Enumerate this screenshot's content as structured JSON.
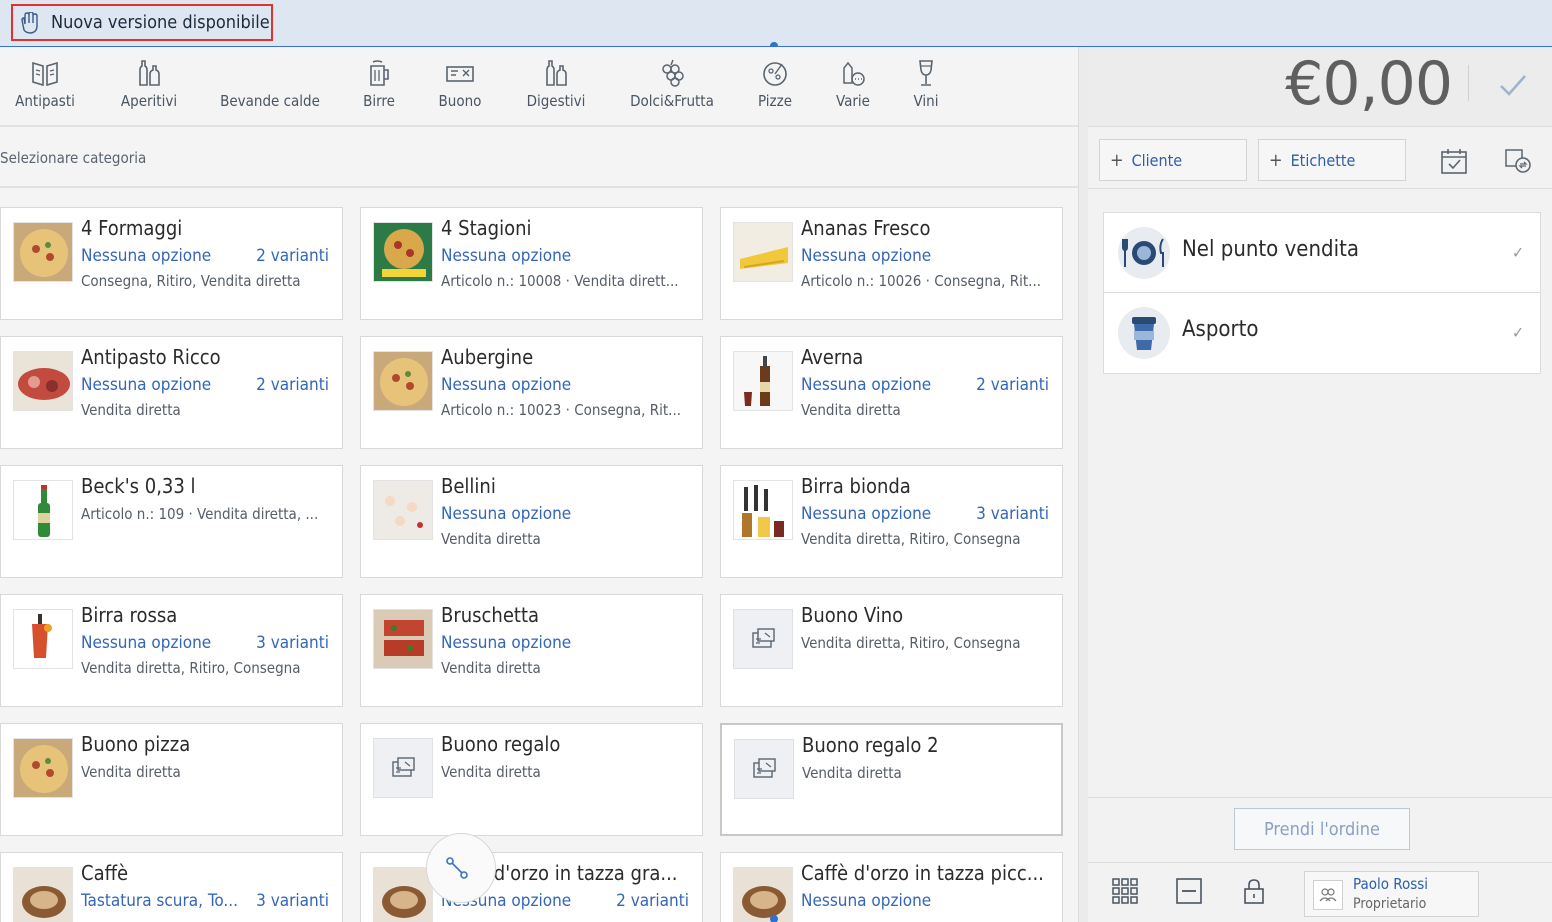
{
  "banner": {
    "text": "Nuova versione disponibile",
    "icon": "hand-wave-icon"
  },
  "categories": [
    {
      "label": "Antipasti",
      "icon": "menu-card-icon"
    },
    {
      "label": "Aperitivi",
      "icon": "bottles-icon"
    },
    {
      "label": "Bevande calde",
      "icon": ""
    },
    {
      "label": "Birre",
      "icon": "beer-mug-icon"
    },
    {
      "label": "Buono",
      "icon": "voucher-icon"
    },
    {
      "label": "Digestivi",
      "icon": "bottles-icon"
    },
    {
      "label": "Dolci&Frutta",
      "icon": "grapes-icon"
    },
    {
      "label": "Pizze",
      "icon": "pizza-icon"
    },
    {
      "label": "Varie",
      "icon": "misc-icon"
    },
    {
      "label": "Vini",
      "icon": "wine-glass-icon"
    }
  ],
  "subheader": "Selezionare categoria",
  "products": [
    {
      "name": "4 Formaggi",
      "option": "Nessuna opzione",
      "variants": "2 varianti",
      "info": "Consegna, Ritiro, Vendita diretta",
      "image": "pizza-photo"
    },
    {
      "name": "4 Stagioni",
      "option": "Nessuna opzione",
      "variants": "",
      "info": "Articolo n.: 10008 · Vendita dirett...",
      "image": "pizza-box-photo"
    },
    {
      "name": "Ananas Fresco",
      "option": "Nessuna opzione",
      "variants": "",
      "info": "Articolo n.: 10026 · Consegna, Rit...",
      "image": "pineapple-photo"
    },
    {
      "name": "Antipasto Ricco",
      "option": "Nessuna opzione",
      "variants": "2 varianti",
      "info": "Vendita diretta",
      "image": "antipasto-photo"
    },
    {
      "name": "Aubergine",
      "option": "Nessuna opzione",
      "variants": "",
      "info": "Articolo n.: 10023 · Consegna, Rit...",
      "image": "pizza-photo"
    },
    {
      "name": "Averna",
      "option": "Nessuna opzione",
      "variants": "2 varianti",
      "info": "Vendita diretta",
      "image": "liquor-photo"
    },
    {
      "name": "Beck's 0,33 l",
      "option": "",
      "variants": "",
      "info": "Articolo n.: 109 · Vendita diretta, ...",
      "image": "beer-bottle-photo"
    },
    {
      "name": "Bellini",
      "option": "Nessuna opzione",
      "variants": "",
      "info": "Vendita diretta",
      "image": "cocktail-photo"
    },
    {
      "name": "Birra bionda",
      "option": "Nessuna opzione",
      "variants": "3 varianti",
      "info": "Vendita diretta, Ritiro, Consegna",
      "image": "beer-tap-photo"
    },
    {
      "name": "Birra rossa",
      "option": "Nessuna opzione",
      "variants": "3 varianti",
      "info": "Vendita diretta, Ritiro, Consegna",
      "image": "red-drink-photo"
    },
    {
      "name": "Bruschetta",
      "option": "Nessuna opzione",
      "variants": "",
      "info": "Vendita diretta",
      "image": "bruschetta-photo"
    },
    {
      "name": "Buono Vino",
      "option": "",
      "variants": "",
      "info": "Vendita diretta, Ritiro, Consegna",
      "image": "voucher-placeholder"
    },
    {
      "name": "Buono pizza",
      "option": "",
      "variants": "",
      "info": "Vendita diretta",
      "image": "pizza-photo"
    },
    {
      "name": "Buono regalo",
      "option": "",
      "variants": "",
      "info": "Vendita diretta",
      "image": "voucher-placeholder"
    },
    {
      "name": "Buono regalo 2",
      "option": "",
      "variants": "",
      "info": "Vendita diretta",
      "image": "voucher-placeholder"
    },
    {
      "name": "Caffè",
      "option": "Tastatura scura, To...",
      "variants": "3 varianti",
      "info": "",
      "image": "coffee-photo"
    },
    {
      "name": "Caffè d'orzo in tazza gra...",
      "option": "Nessuna opzione",
      "variants": "2 varianti",
      "info": "",
      "image": "coffee-photo"
    },
    {
      "name": "Caffè d'orzo in tazza picc...",
      "option": "Nessuna opzione",
      "variants": "",
      "info": "",
      "image": "coffee-photo"
    }
  ],
  "order": {
    "amount": "€0,00",
    "customer_label": "Cliente",
    "tags_label": "Etichette",
    "modes": [
      {
        "label": "Nel punto vendita",
        "icon": "dine-in-icon"
      },
      {
        "label": "Asporto",
        "icon": "takeaway-cup-icon"
      }
    ],
    "take_order_label": "Prendi l'ordine"
  },
  "user": {
    "name": "Paolo Rossi",
    "role": "Proprietario"
  }
}
